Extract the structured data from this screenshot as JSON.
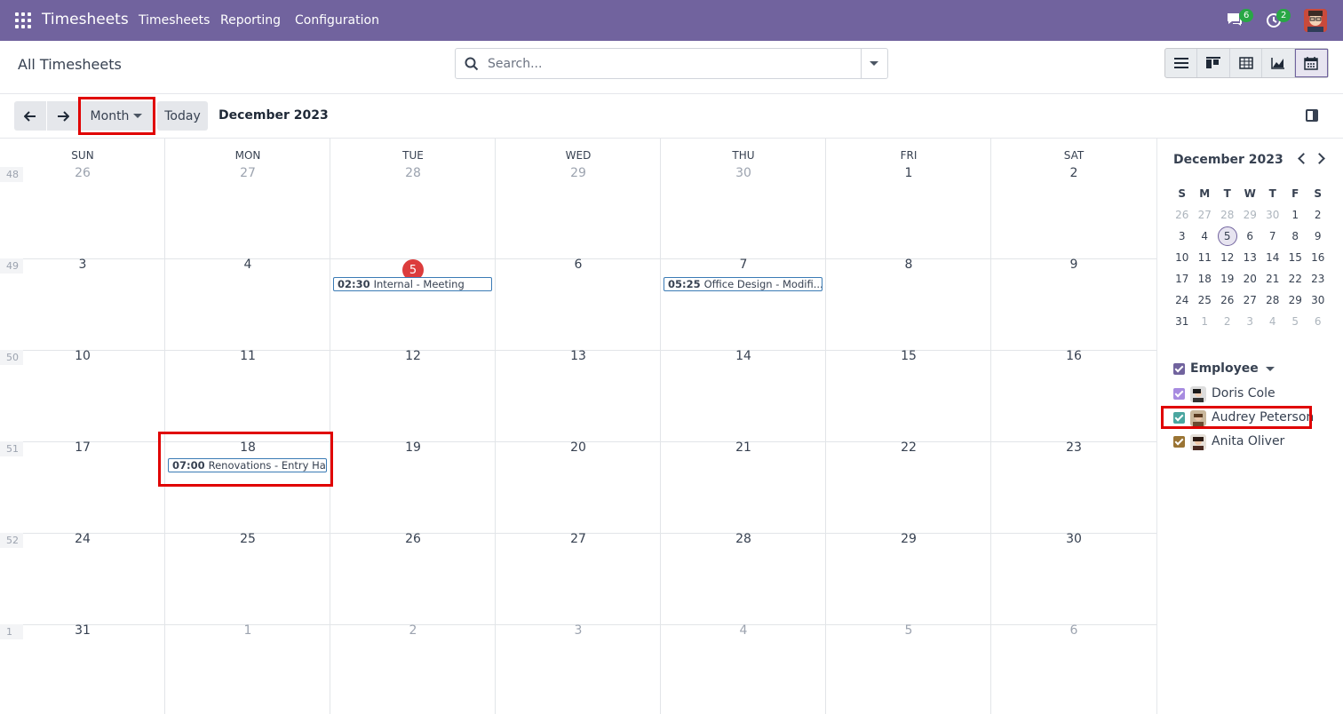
{
  "topbar": {
    "brand": "Timesheets",
    "menu": [
      "Timesheets",
      "Reporting",
      "Configuration"
    ],
    "messages_count": "6",
    "activities_count": "2"
  },
  "control_panel": {
    "title": "All Timesheets",
    "search_placeholder": "Search...",
    "views": [
      "list-icon",
      "kanban-icon",
      "pivot-icon",
      "graph-icon",
      "calendar-icon"
    ]
  },
  "toolbar": {
    "scale": "Month",
    "today": "Today",
    "range_label": "December 2023"
  },
  "calendar": {
    "weekdays": [
      "SUN",
      "MON",
      "TUE",
      "WED",
      "THU",
      "FRI",
      "SAT"
    ],
    "week_numbers": [
      "48",
      "49",
      "50",
      "51",
      "52",
      "1"
    ],
    "weeks": [
      [
        "26",
        "27",
        "28",
        "29",
        "30",
        "1",
        "2"
      ],
      [
        "3",
        "4",
        "5",
        "6",
        "7",
        "8",
        "9"
      ],
      [
        "10",
        "11",
        "12",
        "13",
        "14",
        "15",
        "16"
      ],
      [
        "17",
        "18",
        "19",
        "20",
        "21",
        "22",
        "23"
      ],
      [
        "24",
        "25",
        "26",
        "27",
        "28",
        "29",
        "30"
      ],
      [
        "31",
        "1",
        "2",
        "3",
        "4",
        "5",
        "6"
      ]
    ],
    "events": [
      {
        "time": "02:30",
        "title": "Internal - Meeting"
      },
      {
        "time": "05:25",
        "title": "Office Design - Modifi..."
      },
      {
        "time": "07:00",
        "title": "Renovations - Entry Hall"
      }
    ]
  },
  "sidebar": {
    "mini_title": "December 2023",
    "mini_weekdays": [
      "S",
      "M",
      "T",
      "W",
      "T",
      "F",
      "S"
    ],
    "mini_weeks": [
      [
        "26",
        "27",
        "28",
        "29",
        "30",
        "1",
        "2"
      ],
      [
        "3",
        "4",
        "5",
        "6",
        "7",
        "8",
        "9"
      ],
      [
        "10",
        "11",
        "12",
        "13",
        "14",
        "15",
        "16"
      ],
      [
        "17",
        "18",
        "19",
        "20",
        "21",
        "22",
        "23"
      ],
      [
        "24",
        "25",
        "26",
        "27",
        "28",
        "29",
        "30"
      ],
      [
        "31",
        "1",
        "2",
        "3",
        "4",
        "5",
        "6"
      ]
    ],
    "filter_label": "Employee",
    "people": [
      {
        "name": "Doris Cole",
        "color": "#a78be0"
      },
      {
        "name": "Audrey Peterson",
        "color": "#4aa6a0"
      },
      {
        "name": "Anita Oliver",
        "color": "#9a7434"
      }
    ]
  },
  "colors": {
    "topbar": "#71639e",
    "today": "#dc3c3c",
    "event_border": "#3b7bb5",
    "highlight": "#e00000"
  }
}
